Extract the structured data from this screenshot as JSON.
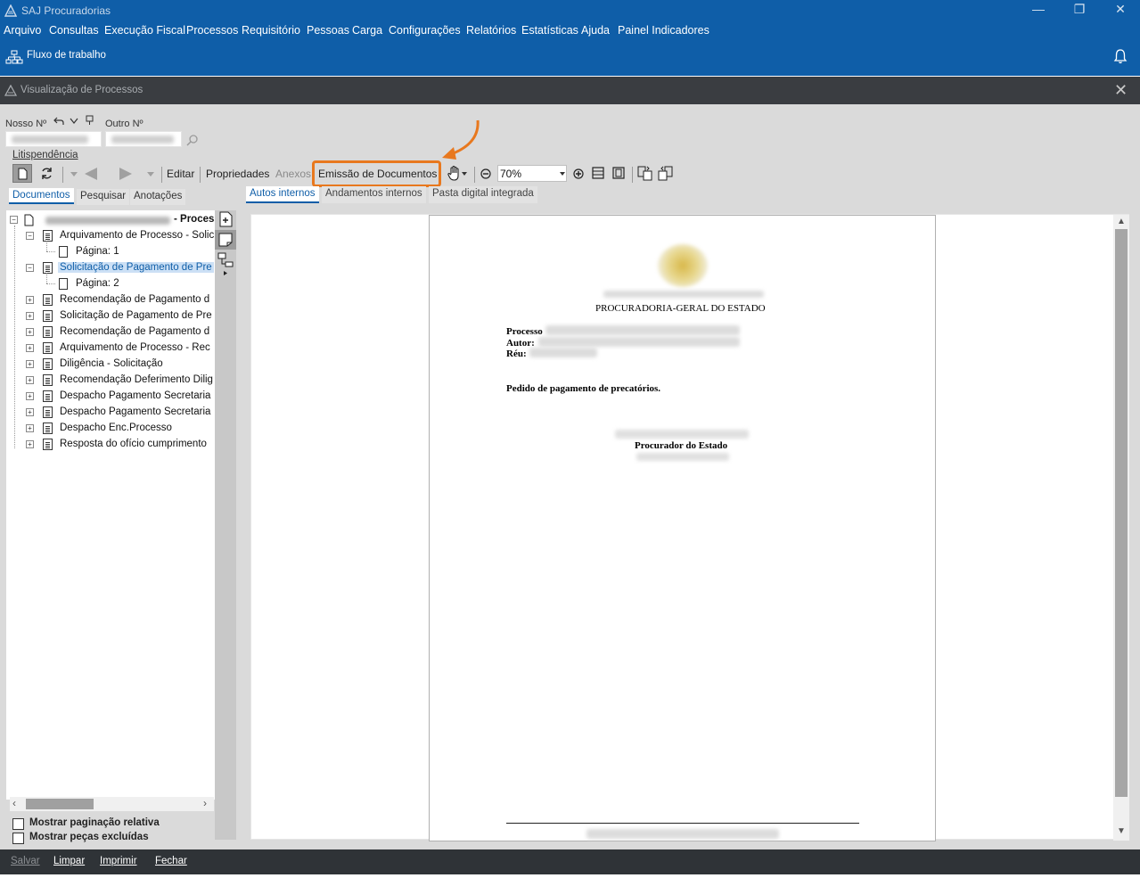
{
  "window": {
    "title": "SAJ Procuradorias",
    "minimize": "—",
    "maximize": "❐",
    "close": "✕"
  },
  "menu": {
    "items": [
      "Arquivo",
      "Consultas",
      "Execução Fiscal",
      "Processos",
      "Requisitório",
      "Pessoas",
      "Carga",
      "Configurações",
      "Relatórios",
      "Estatísticas",
      "Ajuda",
      "Painel Indicadores"
    ]
  },
  "workflow": {
    "label": "Fluxo de trabalho"
  },
  "inner_window": {
    "title": "Visualização de Processos",
    "close": "✕"
  },
  "search": {
    "nosso_label": "Nosso Nº",
    "outro_label": "Outro Nº"
  },
  "litispendencia": "Litispendência",
  "toolbar": {
    "editar": "Editar",
    "propriedades": "Propriedades",
    "anexos": "Anexos",
    "emissao": "Emissão de Documentos",
    "zoom": "70%"
  },
  "left_tabs": [
    "Documentos",
    "Pesquisar",
    "Anotações"
  ],
  "tree": {
    "root_suffix": "- Process",
    "items": [
      {
        "label": "Arquivamento de Processo - Solic",
        "type": "doc",
        "expanded": true
      },
      {
        "label": "Página: 1",
        "type": "page"
      },
      {
        "label": "Solicitação de Pagamento de Pre",
        "type": "doc",
        "expanded": true,
        "selected": true
      },
      {
        "label": "Página: 2",
        "type": "page"
      },
      {
        "label": "Recomendação de Pagamento d",
        "type": "doc"
      },
      {
        "label": "Solicitação de Pagamento de Pre",
        "type": "doc"
      },
      {
        "label": "Recomendação de Pagamento d",
        "type": "doc"
      },
      {
        "label": "Arquivamento de Processo - Rec",
        "type": "doc"
      },
      {
        "label": "Diligência - Solicitação",
        "type": "doc"
      },
      {
        "label": "Recomendação Deferimento Dilig",
        "type": "doc"
      },
      {
        "label": "Despacho Pagamento Secretaria",
        "type": "doc"
      },
      {
        "label": "Despacho Pagamento Secretaria",
        "type": "doc"
      },
      {
        "label": "Despacho Enc.Processo",
        "type": "doc"
      },
      {
        "label": "Resposta do ofício cumprimento",
        "type": "doc"
      }
    ]
  },
  "checkboxes": {
    "paginacao": "Mostrar paginação relativa",
    "excluidas": "Mostrar peças excluídas"
  },
  "right_tabs": [
    "Autos internos",
    "Andamentos internos",
    "Pasta digital integrada"
  ],
  "document": {
    "header": "PROCURADORIA-GERAL DO ESTADO",
    "processo_label": "Processo",
    "autor_label": "Autor:",
    "reu_label": "Réu:",
    "body": "Pedido de pagamento de precatórios.",
    "signature": "Procurador do Estado"
  },
  "bottom": {
    "salvar": "Salvar",
    "limpar": "Limpar",
    "imprimir": "Imprimir",
    "fechar": "Fechar"
  },
  "colors": {
    "brand_blue": "#0f5ea8",
    "highlight_orange": "#e8781e"
  }
}
